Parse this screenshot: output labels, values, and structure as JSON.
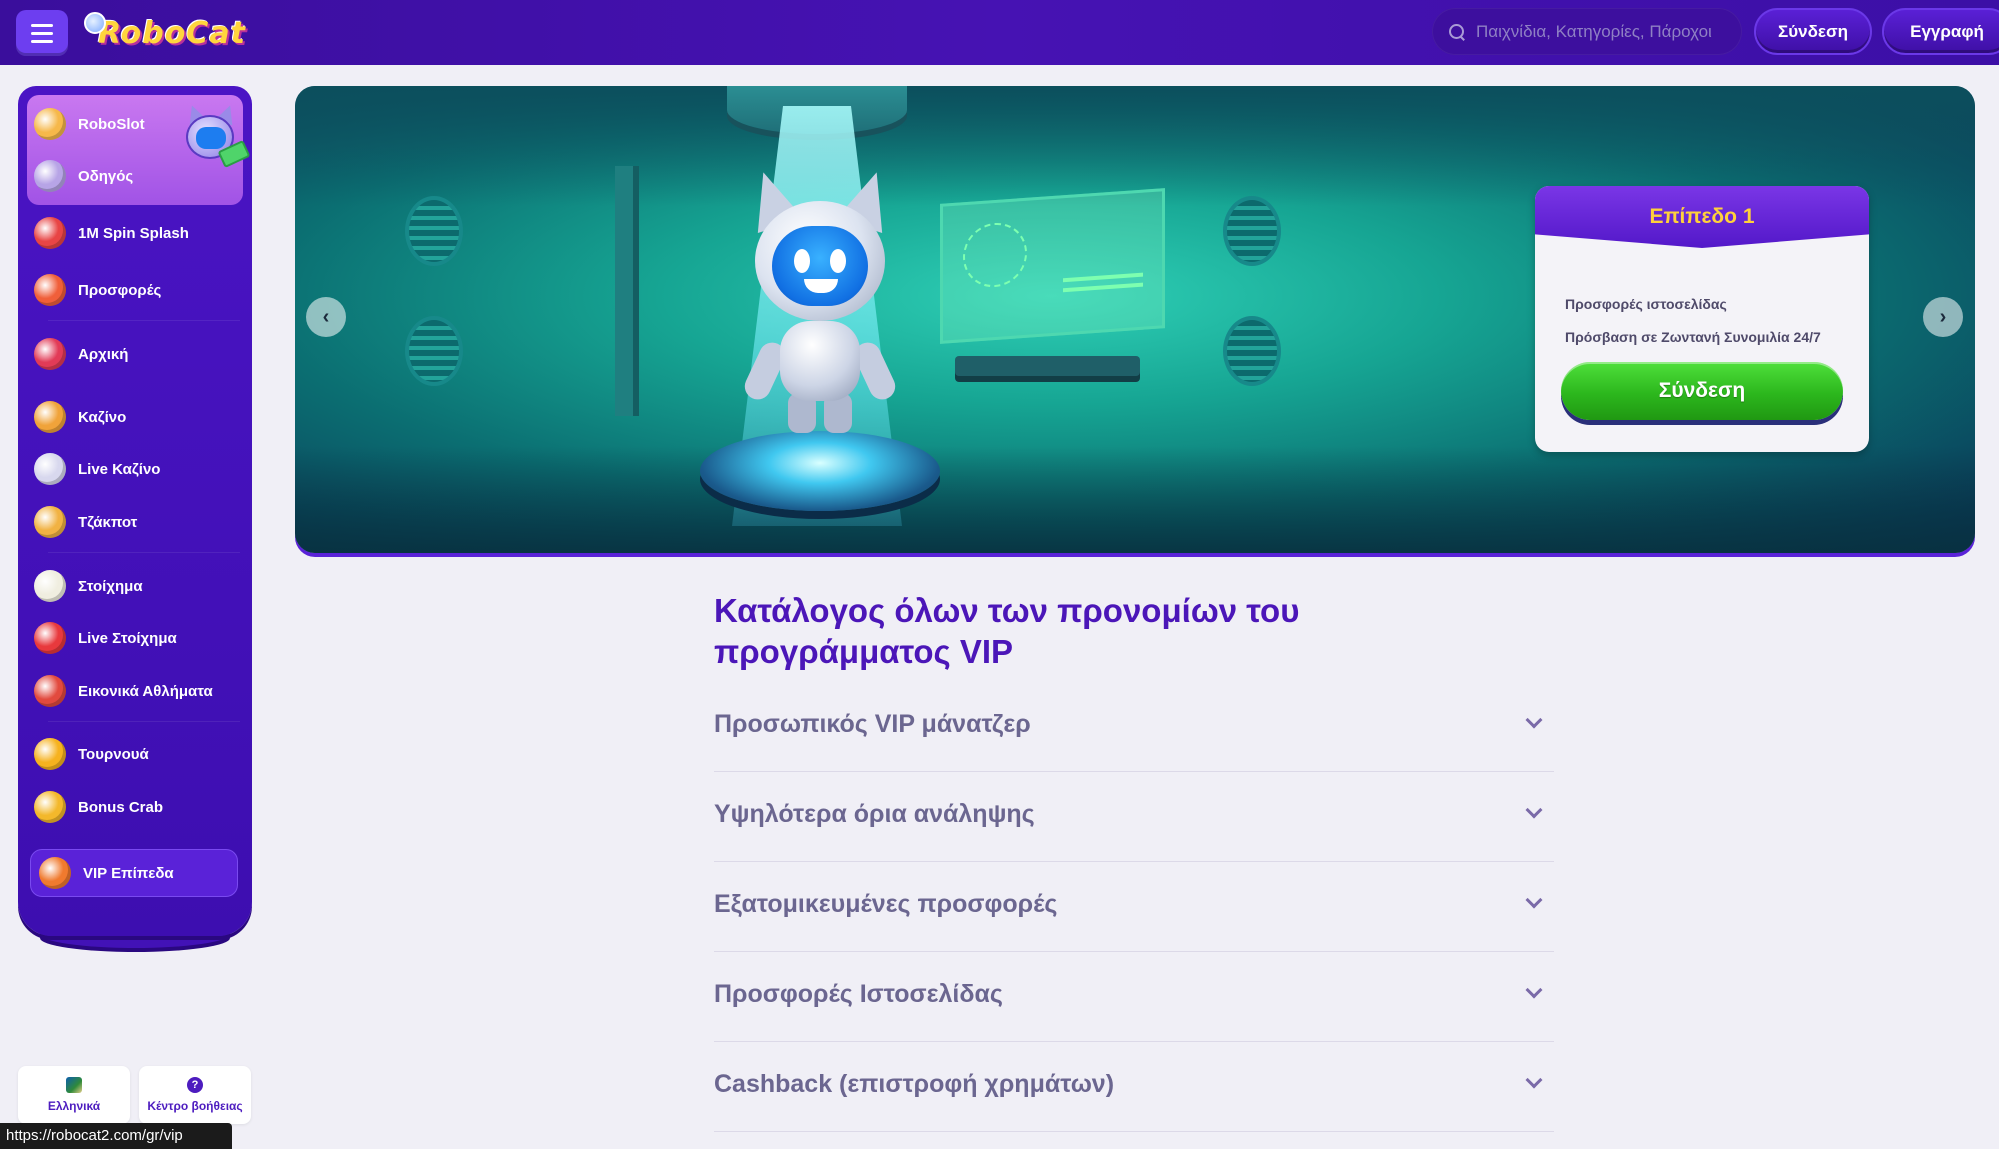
{
  "header": {
    "logo_text": "RoboCat",
    "search_placeholder": "Παιχνίδια, Κατηγορίες, Πάροχοι",
    "login_label": "Σύνδεση",
    "register_label": "Εγγραφή"
  },
  "sidebar": {
    "top_items": [
      {
        "label": "RoboSlot",
        "icon": "roboslot-icon",
        "color": "#f6b84a"
      },
      {
        "label": "Οδηγός",
        "icon": "guide-icon",
        "color": "#b7a4e6"
      }
    ],
    "items": [
      {
        "label": "1M Spin Splash",
        "icon": "spin-splash-icon",
        "color": "#e84545"
      },
      {
        "label": "Προσφορές",
        "icon": "gift-icon",
        "color": "#f05f3a"
      },
      {
        "label": "Αρχική",
        "icon": "home-icon",
        "color": "#e23b57"
      },
      {
        "label": "Καζίνο",
        "icon": "casino-icon",
        "color": "#f0a33a"
      },
      {
        "label": "Live Καζίνο",
        "icon": "live-casino-icon",
        "color": "#d8d8ee"
      },
      {
        "label": "Τζάκποτ",
        "icon": "jackpot-icon",
        "color": "#f1b243"
      },
      {
        "label": "Στοίχημα",
        "icon": "soccer-ball-icon",
        "color": "#f0eee0"
      },
      {
        "label": "Live Στοίχημα",
        "icon": "live-betting-icon",
        "color": "#e8393d"
      },
      {
        "label": "Εικονικά Αθλήματα",
        "icon": "virtual-sports-icon",
        "color": "#e24a3e"
      },
      {
        "label": "Τουρνουά",
        "icon": "trophy-icon",
        "color": "#f6b21f"
      },
      {
        "label": "Bonus Crab",
        "icon": "bonus-crab-icon",
        "color": "#f3b82b"
      }
    ],
    "vip": {
      "label": "VIP Επίπεδα",
      "icon": "vip-icon",
      "color": "#f07a2e"
    },
    "language_label": "Ελληνικά",
    "help_label": "Κέντρο βοήθειας"
  },
  "banner": {
    "level_title": "Επίπεδο 1",
    "perks": [
      "Προσφορές ιστοσελίδας",
      "Πρόσβαση σε Ζωντανή Συνομιλία 24/7"
    ],
    "login_label": "Σύνδεση"
  },
  "main": {
    "title": "Κατάλογος όλων των προνομίων του προγράμματος VIP",
    "accordion": [
      "Προσωπικός VIP μάνατζερ",
      "Υψηλότερα όρια ανάληψης",
      "Εξατομικευμένες προσφορές",
      "Προσφορές Ιστοσελίδας",
      "Cashback (επιστροφή χρημάτων)"
    ]
  },
  "status_url": "https://robocat2.com/gr/vip",
  "colors": {
    "header_bg": "#4612b3",
    "sidebar_bg": "#4a14c4",
    "title": "#4b16b8",
    "level_title": "#ffd13b",
    "login_green": "#2cb71d"
  }
}
